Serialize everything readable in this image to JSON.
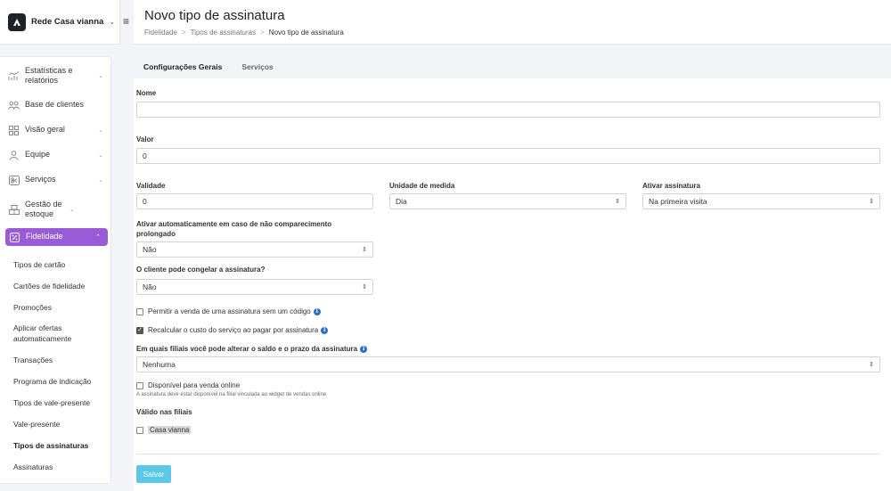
{
  "brand": {
    "name": "Rede Casa vianna"
  },
  "header": {
    "title": "Novo tipo de assinatura",
    "breadcrumb": [
      "Fidelidade",
      "Tipos de assinaturas",
      "Novo tipo de assinatura"
    ]
  },
  "sidebar": {
    "items": [
      {
        "label": "Estatísticas e relatórios",
        "icon": "chart-line-icon"
      },
      {
        "label": "Base de clientes",
        "icon": "users-icon"
      },
      {
        "label": "Visão geral",
        "icon": "grid-icon"
      },
      {
        "label": "Equipe",
        "icon": "person-icon"
      },
      {
        "label": "Serviços",
        "icon": "scissors-icon"
      },
      {
        "label": "Gestão de estoque",
        "icon": "boxes-icon"
      },
      {
        "label": "Fidelidade",
        "icon": "percent-icon"
      }
    ],
    "subitems": [
      "Tipos de cartão",
      "Cartões de fidelidade",
      "Promoções",
      "Aplicar ofertas automaticamente",
      "Transações",
      "Programa de indicação",
      "Tipos de vale-presente",
      "Vale-presente",
      "Tipos de assinaturas",
      "Assinaturas"
    ]
  },
  "tabs": [
    "Configurações Gerais",
    "Serviços"
  ],
  "form": {
    "name_label": "Nome",
    "name_value": "",
    "value_label": "Valor",
    "value_value": "0",
    "validity_label": "Validade",
    "validity_value": "0",
    "unit_label": "Unidade de medida",
    "unit_value": "Dia",
    "activate_label": "Ativar assinatura",
    "activate_value": "Na primeira visita",
    "auto_activate_label": "Ativar automaticamente em caso de não comparecimento prolongado",
    "auto_activate_value": "Não",
    "freeze_label": "O cliente pode congelar a assinatura?",
    "freeze_value": "Não",
    "allow_sale_label": "Permitir a venda de uma assinatura sem um código",
    "recalc_label": "Recalcular o custo do serviço ao pagar por assinatura",
    "branches_label": "Em quais filiais você pode alterar o saldo e o prazo da assinatura",
    "branches_value": "Nenhuma",
    "online_label": "Disponível para venda online",
    "online_hint": "A assinatura deve estar disponível na filial vinculada ao widget de vendas online",
    "valid_branches_label": "Válido nas filiais",
    "branch_name": "Casa vianna",
    "save_label": "Salvar"
  },
  "colors": {
    "accent": "#9a5bd9",
    "save": "#5bc8e8",
    "info": "#2f6fc6"
  }
}
